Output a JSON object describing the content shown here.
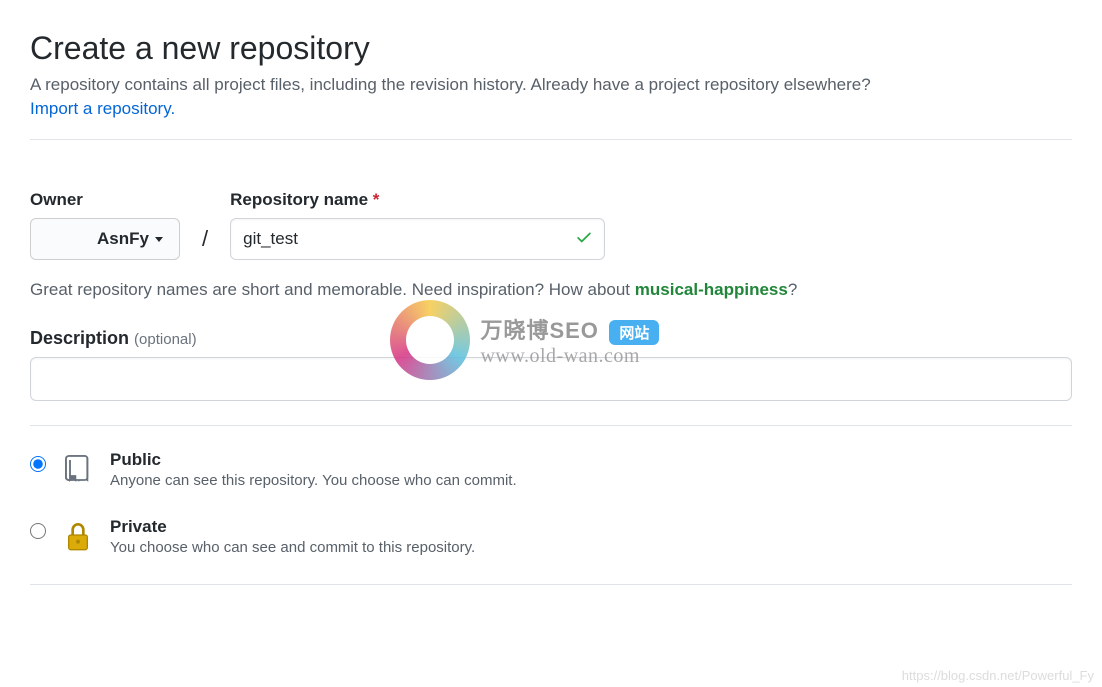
{
  "header": {
    "title": "Create a new repository",
    "subtitle": "A repository contains all project files, including the revision history. Already have a project repository elsewhere?",
    "import_link": "Import a repository."
  },
  "owner": {
    "label": "Owner",
    "selected": "AsnFy"
  },
  "repo_name": {
    "label": "Repository name",
    "required_mark": "*",
    "value": "git_test"
  },
  "hint": {
    "prefix": "Great repository names are short and memorable. Need inspiration? How about ",
    "suggestion": "musical-happiness",
    "suffix": "?"
  },
  "description": {
    "label": "Description",
    "optional": "(optional)",
    "value": ""
  },
  "visibility": {
    "public": {
      "title": "Public",
      "desc": "Anyone can see this repository. You choose who can commit."
    },
    "private": {
      "title": "Private",
      "desc": "You choose who can see and commit to this repository."
    }
  },
  "watermark": {
    "title": "万晓博SEO",
    "badge": "网站",
    "url": "www.old-wan.com",
    "blog": "https://blog.csdn.net/Powerful_Fy"
  }
}
